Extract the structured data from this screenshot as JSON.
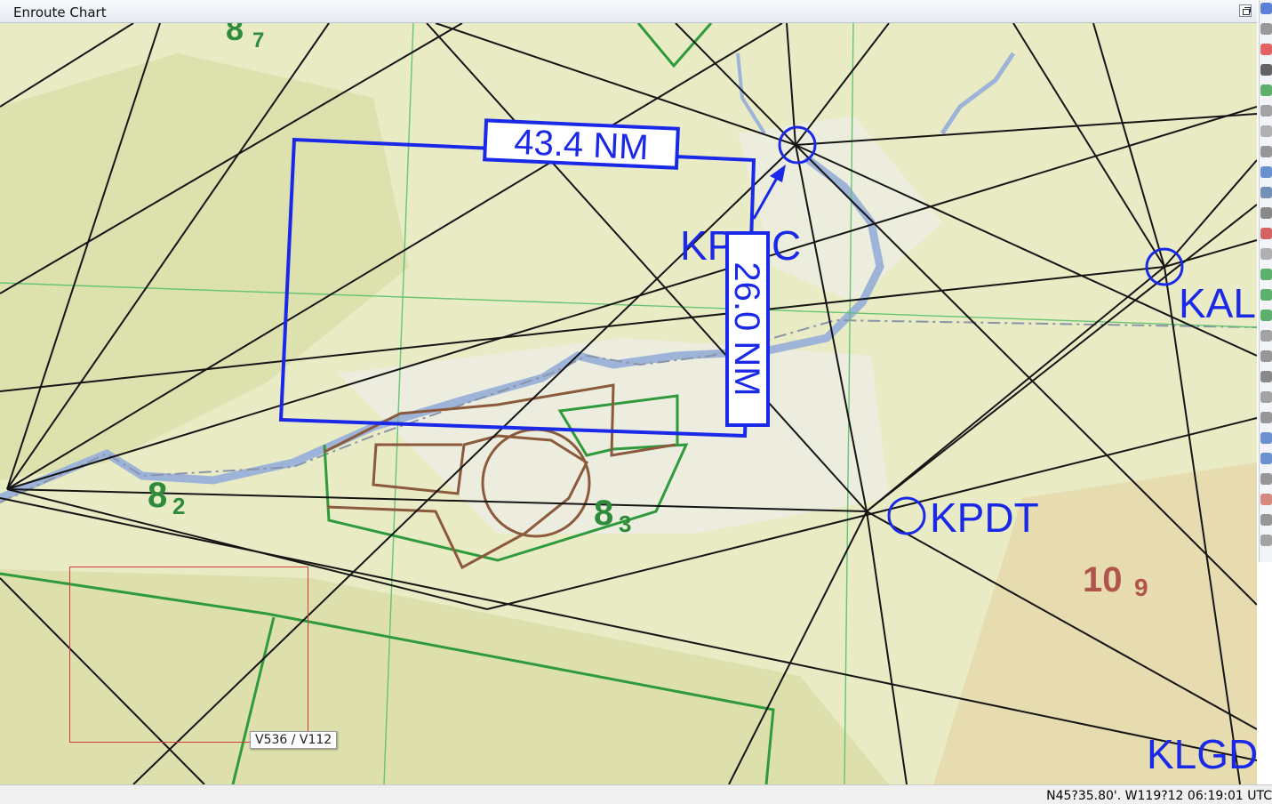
{
  "window": {
    "title": "Enroute Chart"
  },
  "map": {
    "measure_horizontal": "43.4 NM",
    "measure_vertical": "26.0 NM",
    "airports": [
      "KPSC",
      "KALW",
      "KPDT",
      "KLGD"
    ],
    "airport_labels_visible": {
      "psc": "KP",
      "psc2": "C",
      "alw": "KAL",
      "pdt": "KPDT",
      "lgd": "KLGD"
    },
    "mef": [
      {
        "big": "8",
        "small": "7",
        "color": "#2e8b3c"
      },
      {
        "big": "8",
        "small": "2",
        "color": "#2e8b3c"
      },
      {
        "big": "8",
        "small": "3",
        "color": "#2e8b3c"
      },
      {
        "big": "10",
        "small": "9",
        "color": "#b0544c"
      }
    ],
    "colors": {
      "route": "#111111",
      "measure": "#1a28e8",
      "restricted": "#8b5a3c",
      "airspace": "#2e9a3c"
    }
  },
  "tooltip": "V536 / V112",
  "status": {
    "coords": "N45?35.80'. W119?12 06:19:01 UTC"
  },
  "toolbar": {
    "icons": [
      "compass-icon",
      "wrench-icon",
      "record-icon",
      "crosshair-icon",
      "g-icon",
      "pen-icon",
      "triangle-icon",
      "arrow-icon",
      "grid-icon",
      "layers-icon",
      "arc-icon",
      "frame-icon",
      "pointer-icon",
      "phone-icon",
      "plus-icon",
      "five-icon",
      "circle-icon",
      "loop-icon",
      "line-icon",
      "hash-icon",
      "box-icon",
      "cursor-icon",
      "arrow2-icon",
      "rotate-icon",
      "flag-icon",
      "cut-icon",
      "line2-icon"
    ]
  }
}
